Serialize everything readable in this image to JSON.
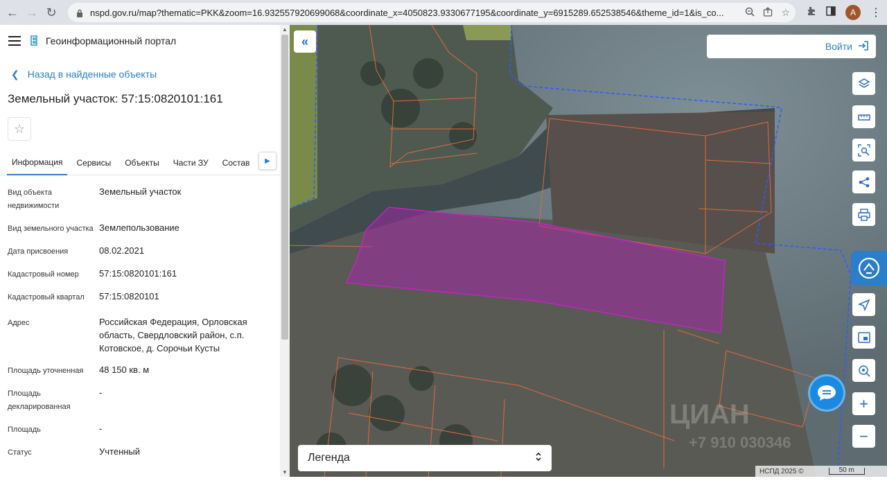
{
  "browser": {
    "url": "nspd.gov.ru/map?thematic=PKK&zoom=16.932557920699068&coordinate_x=4050823.9330677195&coordinate_y=6915289.652538546&theme_id=1&is_co...",
    "profile_initial": "A"
  },
  "panel": {
    "portal_title": "Геоинформационный портал",
    "back_label": "Назад в найденные объекты",
    "object_title": "Земельный участок: 57:15:0820101:161",
    "tabs": [
      "Информация",
      "Сервисы",
      "Объекты",
      "Части ЗУ",
      "Состав"
    ],
    "properties": [
      {
        "key": "Вид объекта недвижимости",
        "value": "Земельный участок"
      },
      {
        "key": "Вид земельного участка",
        "value": "Землепользование"
      },
      {
        "key": "Дата присвоения",
        "value": "08.02.2021"
      },
      {
        "key": "Кадастровый номер",
        "value": "57:15:0820101:161"
      },
      {
        "key": "Кадастровый квартал",
        "value": "57:15:0820101"
      },
      {
        "key": "Адрес",
        "value": "Российская Федерация, Орловская область, Свердловский район, с.п. Котовское, д. Сорочьи Кусты"
      },
      {
        "key": "Площадь уточненная",
        "value": "48 150 кв. м"
      },
      {
        "key": "Площадь декларированная",
        "value": "-"
      },
      {
        "key": "Площадь",
        "value": "-"
      },
      {
        "key": "Статус",
        "value": "Учтенный"
      }
    ]
  },
  "map": {
    "login_label": "Войти",
    "legend_label": "Легенда",
    "attribution": "НСПД 2025 ©",
    "scale_label": "50 m",
    "watermark": "ЦИАН",
    "watermark_phone": "+7 910 030346",
    "colors": {
      "selected_parcel": "#c026c0",
      "parcel_border": "#e06a3a",
      "quarter_border": "#2a5cff",
      "accent": "#2b7ec9"
    }
  }
}
